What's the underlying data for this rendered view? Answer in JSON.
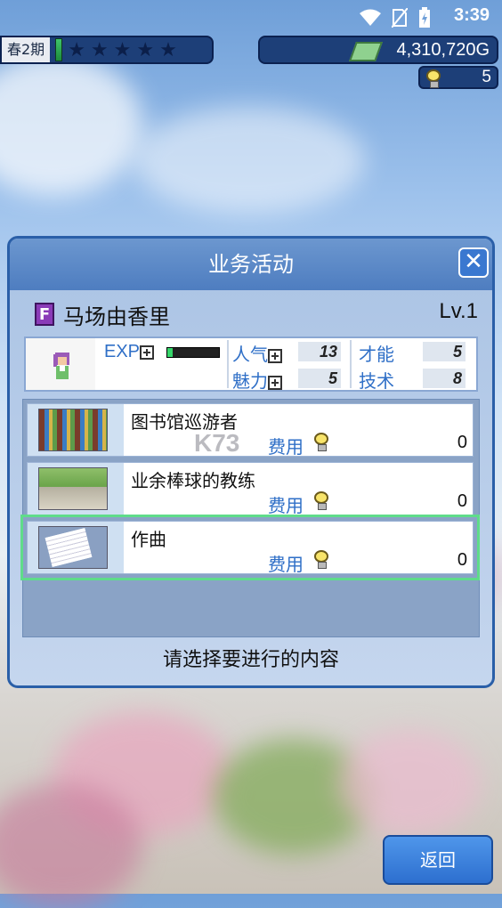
{
  "status_bar": {
    "time": "3:39",
    "icons": [
      "wifi-icon",
      "no-sim-icon",
      "battery-charging-icon"
    ]
  },
  "hud": {
    "season": "春2期",
    "stars": [
      "★",
      "★",
      "★",
      "★",
      "★"
    ],
    "money": "4,310,720G",
    "ideas": "5"
  },
  "dialog": {
    "title": "业务活动",
    "close_icon": "close-icon",
    "character": {
      "rank": "F",
      "name": "马场由香里",
      "level": "Lv.1",
      "exp_label": "EXP",
      "exp_fill_fraction": 0.1,
      "stats": {
        "popularity_label": "人气",
        "popularity": "13",
        "charm_label": "魅力",
        "charm": "5",
        "talent_label": "才能",
        "talent": "5",
        "technique_label": "技术",
        "technique": "8"
      }
    },
    "activities": [
      {
        "name": "图书馆巡游者",
        "cost_label": "费用",
        "cost": "0",
        "image": "bookshelf"
      },
      {
        "name": "业余棒球的教练",
        "cost_label": "费用",
        "cost": "0",
        "image": "baseball-field"
      },
      {
        "name": "作曲",
        "cost_label": "费用",
        "cost": "0",
        "image": "sheet-music",
        "selected": true
      }
    ],
    "hint": "请选择要进行的内容"
  },
  "watermark": "K73",
  "back_button": "返回",
  "colors": {
    "accent_blue": "#2f6fc7",
    "hud_navy": "#1d3f78",
    "selection_green": "#5fdc8a",
    "exp_green": "#36d66a"
  }
}
